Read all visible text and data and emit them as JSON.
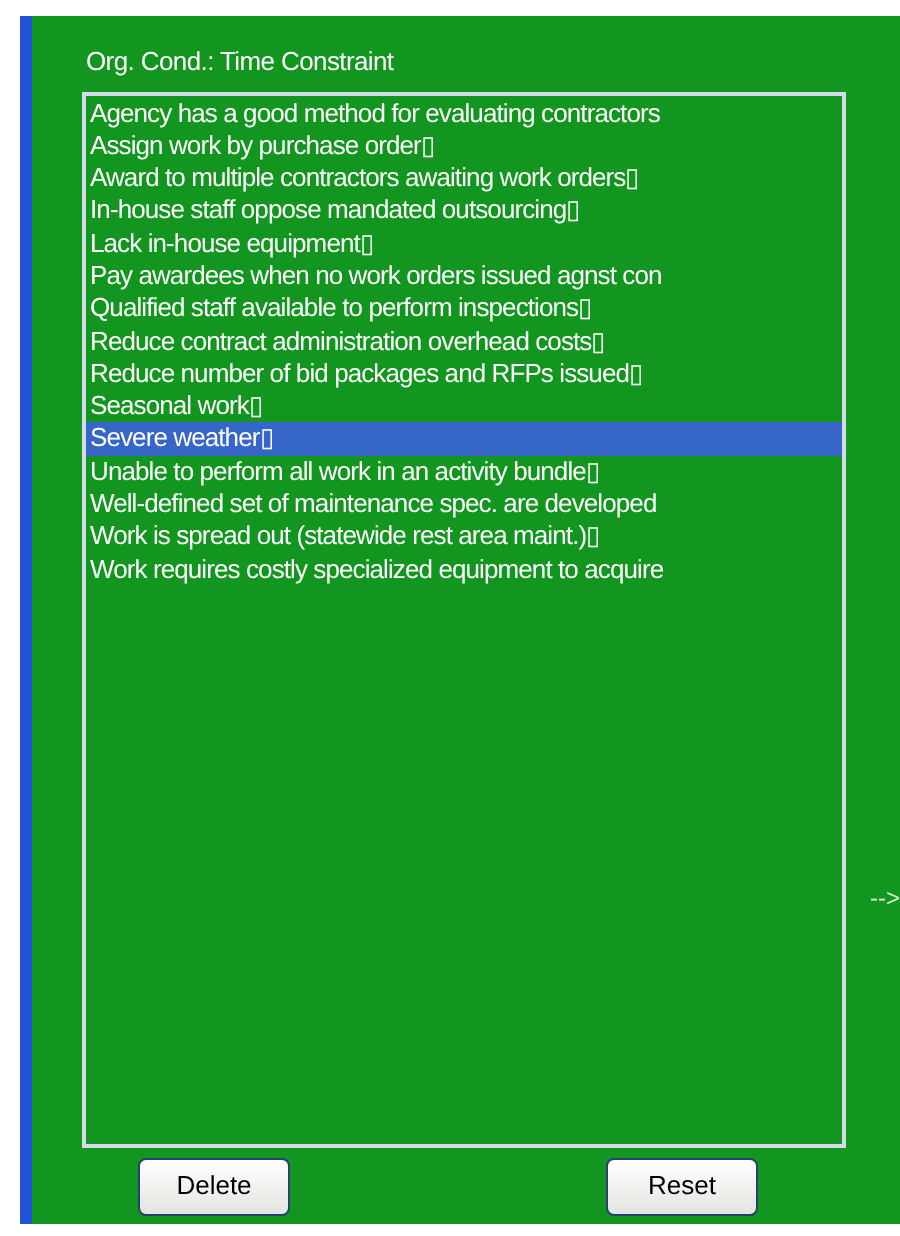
{
  "panel": {
    "title": "Org. Cond.: Time Constraint"
  },
  "list": {
    "items": [
      {
        "label": "Agency has a good method for evaluating contractors",
        "selected": false
      },
      {
        "label": "Assign work by purchase order▯",
        "selected": false
      },
      {
        "label": "Award to multiple contractors awaiting work orders▯",
        "selected": false
      },
      {
        "label": "In-house staff oppose mandated outsourcing▯",
        "selected": false
      },
      {
        "label": "Lack in-house equipment▯",
        "selected": false
      },
      {
        "label": "Pay awardees when no work orders issued agnst con",
        "selected": false
      },
      {
        "label": "Qualified staff available to perform inspections▯",
        "selected": false
      },
      {
        "label": "Reduce contract administration overhead costs▯",
        "selected": false
      },
      {
        "label": "Reduce number of bid packages and RFPs issued▯",
        "selected": false
      },
      {
        "label": "Seasonal work▯",
        "selected": false
      },
      {
        "label": "Severe weather▯",
        "selected": true
      },
      {
        "label": "Unable to perform all work in an activity bundle▯",
        "selected": false
      },
      {
        "label": "Well-defined set of maintenance spec. are developed",
        "selected": false
      },
      {
        "label": "Work is spread out (statewide rest area maint.)▯",
        "selected": false
      },
      {
        "label": "Work requires costly specialized equipment to acquire",
        "selected": false
      }
    ]
  },
  "buttons": [
    "Delete",
    "Reset"
  ],
  "arrow": "-->"
}
